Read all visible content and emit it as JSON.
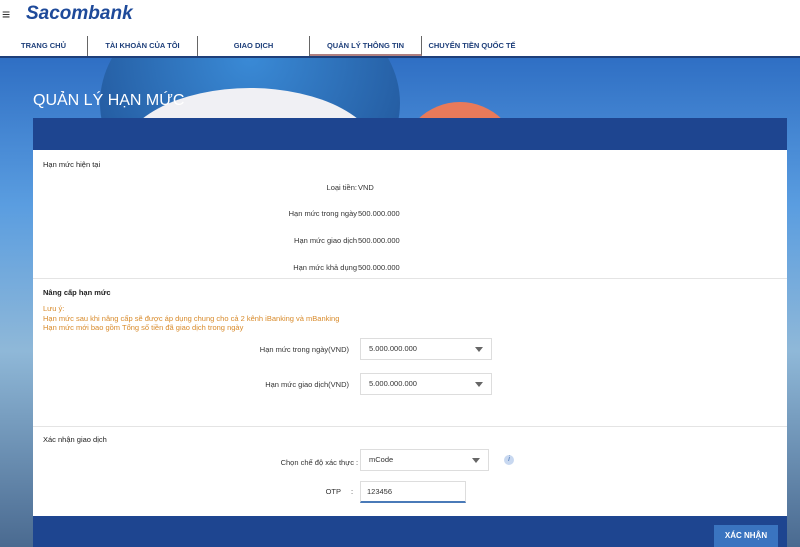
{
  "header": {
    "brand": "Sacombank",
    "menu_icon": "≡"
  },
  "nav": [
    "TRANG CHỦ",
    "TÀI KHOẢN CỦA TÔI",
    "GIAO DỊCH",
    "QUẢN LÝ THÔNG TIN",
    "CHUYỂN TIỀN QUỐC TẾ"
  ],
  "page_title": "QUẢN LÝ HẠN MỨC",
  "current": {
    "heading": "Hạn mức hiện tại",
    "rows": [
      {
        "label": "Loại tiền:",
        "value": "VND"
      },
      {
        "label": "Hạn mức trong ngày",
        "value": "500.000.000"
      },
      {
        "label": "Hạn mức giao dịch",
        "value": "500.000.000"
      },
      {
        "label": "Hạn mức khả dụng",
        "value": "500.000.000"
      }
    ]
  },
  "upgrade": {
    "heading": "Nâng cấp hạn mức",
    "notes": [
      "Lưu ý:",
      "Hạn mức sau khi nâng cấp sẽ được áp dụng chung cho cả 2 kênh iBanking và mBanking",
      "Hạn mức mới bao gồm Tổng số tiền đã giao dịch trong ngày"
    ],
    "daily_label": "Hạn mức trong ngày(VND)",
    "daily_value": "5.000.000.000",
    "txn_label": "Hạn mức giao dịch(VND)",
    "txn_value": "5.000.000.000"
  },
  "confirm": {
    "heading": "Xác nhận giao dịch",
    "auth_label": "Chọn chế độ xác thực",
    "auth_value": "mCode",
    "otp_label": "OTP",
    "otp_value": "123456",
    "colon": ":",
    "info": "i"
  },
  "submit": "XÁC NHẬN"
}
